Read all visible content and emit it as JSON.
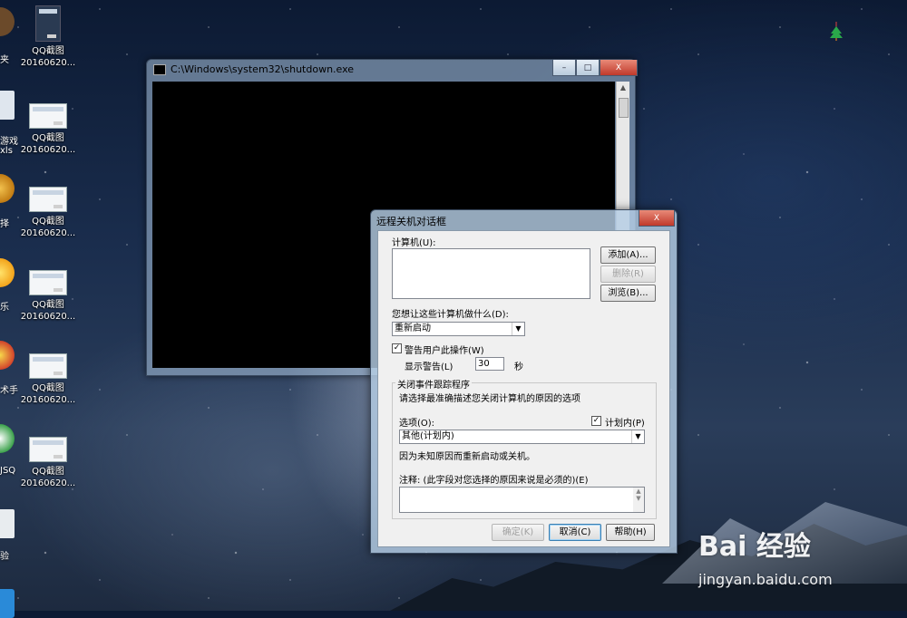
{
  "desktop": {
    "right_icons": [
      {
        "label1": "QQ截图",
        "label2": "20160620..."
      },
      {
        "label1": "QQ截图",
        "label2": "20160620..."
      },
      {
        "label1": "QQ截图",
        "label2": "20160620..."
      },
      {
        "label1": "QQ截图",
        "label2": "20160620..."
      },
      {
        "label1": "QQ截图",
        "label2": "20160620..."
      },
      {
        "label1": "QQ截图",
        "label2": "20160620..."
      }
    ],
    "left_labels": [
      "夹",
      "游戏",
      "xls",
      "择",
      "乐",
      "术手",
      "JSQ",
      "验"
    ]
  },
  "console": {
    "title": "C:\\Windows\\system32\\shutdown.exe",
    "minimize": "–",
    "maximize": "□",
    "close": "X"
  },
  "dialog": {
    "title": "远程关机对话框",
    "close": "X",
    "computers_label": "计算机(U):",
    "add_button": "添加(A)...",
    "remove_button": "删除(R)",
    "browse_button": "浏览(B)...",
    "action_label": "您想让这些计算机做什么(D):",
    "action_value": "重新启动",
    "warn_check": "✓",
    "warn_label": "警告用户此操作(W)",
    "display_warning_label": "显示警告(L)",
    "warning_seconds": "30",
    "seconds_unit": "秒",
    "tracker_group": "关闭事件跟踪程序",
    "tracker_desc": "请选择最准确描述您关闭计算机的原因的选项",
    "option_label": "选项(O):",
    "planned_check": "✓",
    "planned_label": "计划内(P)",
    "option_value": "其他(计划内)",
    "reason_desc": "因为未知原因而重新启动或关机。",
    "comment_label": "注释: (此字段对您选择的原因来说是必须的)(E)",
    "ok_button": "确定(K)",
    "cancel_button": "取消(C)",
    "help_button": "帮助(H)"
  },
  "watermark": {
    "logo": "Bai 经验",
    "url": "jingyan.baidu.com"
  }
}
